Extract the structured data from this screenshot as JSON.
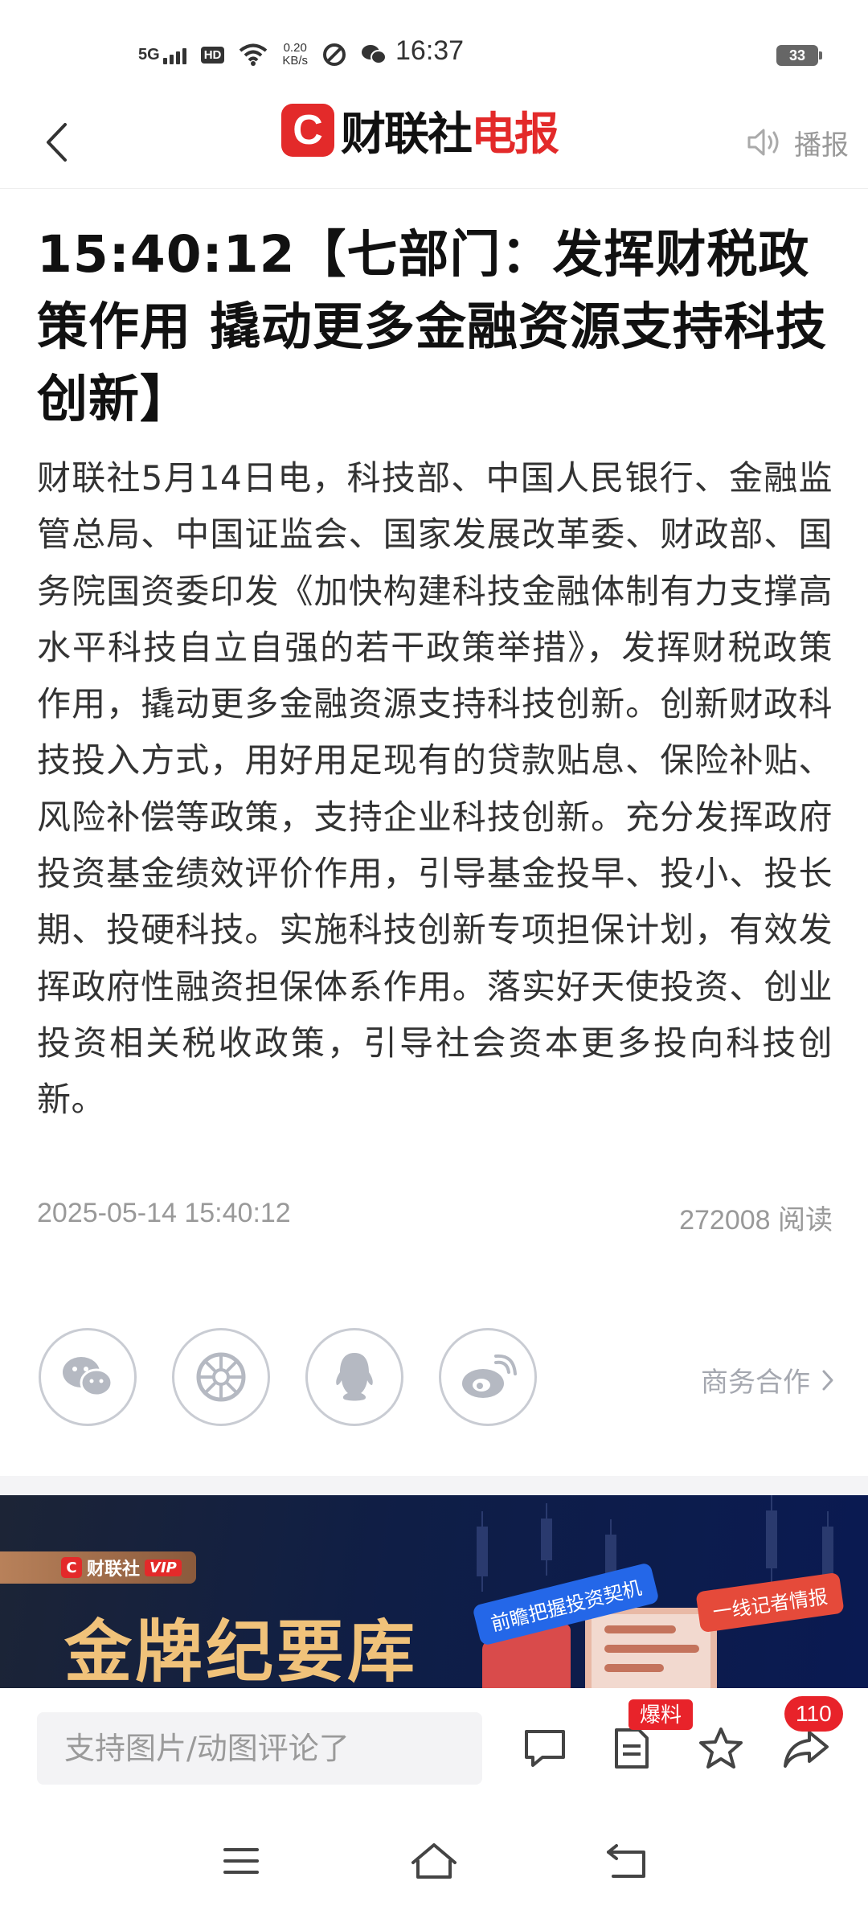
{
  "status_bar": {
    "network": "5G",
    "hd": "HD",
    "speed_value": "0.20",
    "speed_unit": "KB/s",
    "time": "16:37",
    "battery": "33"
  },
  "nav": {
    "logo_mark": "C",
    "logo_black": "财联社",
    "logo_red": "电报",
    "broadcast_label": "播报"
  },
  "article": {
    "headline": "15:40:12【七部门：发挥财税政策作用 撬动更多金融资源支持科技创新】",
    "body": "财联社5月14日电，科技部、中国人民银行、金融监管总局、中国证监会、国家发展改革委、财政部、国务院国资委印发《加快构建科技金融体制有力支撑高水平科技自立自强的若干政策举措》，发挥财税政策作用，撬动更多金融资源支持科技创新。创新财政科技投入方式，用好用足现有的贷款贴息、保险补贴、风险补偿等政策，支持企业科技创新。充分发挥政府投资基金绩效评价作用，引导基金投早、投小、投长期、投硬科技。实施科技创新专项担保计划，有效发挥政府性融资担保体系作用。落实好天使投资、创业投资相关税收政策，引导社会资本更多投向科技创新。",
    "datetime": "2025-05-14 15:40:12",
    "read_count": "272008 阅读"
  },
  "share": {
    "buttons": [
      "wechat-icon",
      "moments-icon",
      "qq-icon",
      "weibo-icon"
    ],
    "business_label": "商务合作"
  },
  "banner": {
    "brand": "财联社",
    "vip": "VIP",
    "title": "金牌纪要库",
    "tag_blue": "前瞻把握投资契机",
    "tag_red": "一线记者情报"
  },
  "bottom_bar": {
    "comment_placeholder": "支持图片/动图评论了",
    "report_badge": "爆料",
    "share_count": "110"
  },
  "colors": {
    "brand_red": "#e32a2a",
    "badge_red": "#e8232a",
    "banner_gold": "#f0c27a"
  }
}
